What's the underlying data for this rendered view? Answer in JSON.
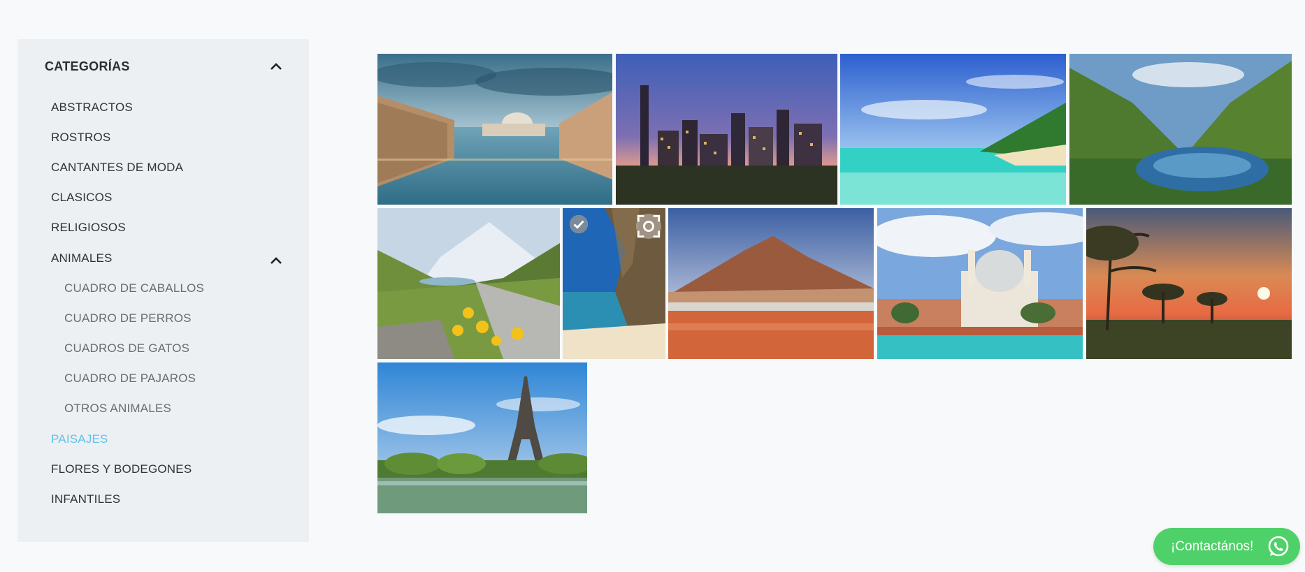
{
  "sidebar": {
    "title": "CATEGORÍAS",
    "items": [
      {
        "label": "ABSTRACTOS"
      },
      {
        "label": "ROSTROS"
      },
      {
        "label": "CANTANTES DE MODA"
      },
      {
        "label": "CLASICOS"
      },
      {
        "label": "RELIGIOSOS"
      },
      {
        "label": "ANIMALES"
      },
      {
        "label": "CUADRO DE CABALLOS"
      },
      {
        "label": "CUADRO DE PERROS"
      },
      {
        "label": "CUADROS DE GATOS"
      },
      {
        "label": "CUADRO DE PAJAROS"
      },
      {
        "label": "OTROS ANIMALES"
      },
      {
        "label": "PAISAJES"
      },
      {
        "label": "FLORES Y BODEGONES"
      },
      {
        "label": "INFANTILES"
      }
    ],
    "active_color": "#5fc2ea"
  },
  "gallery": {
    "tiles": [
      {
        "subject": "venice-canal"
      },
      {
        "subject": "city-skyline-dusk"
      },
      {
        "subject": "tropical-beach"
      },
      {
        "subject": "mountain-lake"
      },
      {
        "subject": "alpine-valley-flowers"
      },
      {
        "subject": "sea-cliff-beach"
      },
      {
        "subject": "desert-volcano-lagoon"
      },
      {
        "subject": "venice-basilica"
      },
      {
        "subject": "savanna-sunset"
      },
      {
        "subject": "eiffel-tower"
      }
    ]
  },
  "contact": {
    "label": "¡Contactános!",
    "color": "#4fd16a"
  },
  "icons": {
    "collapse": "chevron-up-icon",
    "check": "check-circle-icon",
    "focus": "focus-icon",
    "whatsapp": "whatsapp-icon"
  }
}
